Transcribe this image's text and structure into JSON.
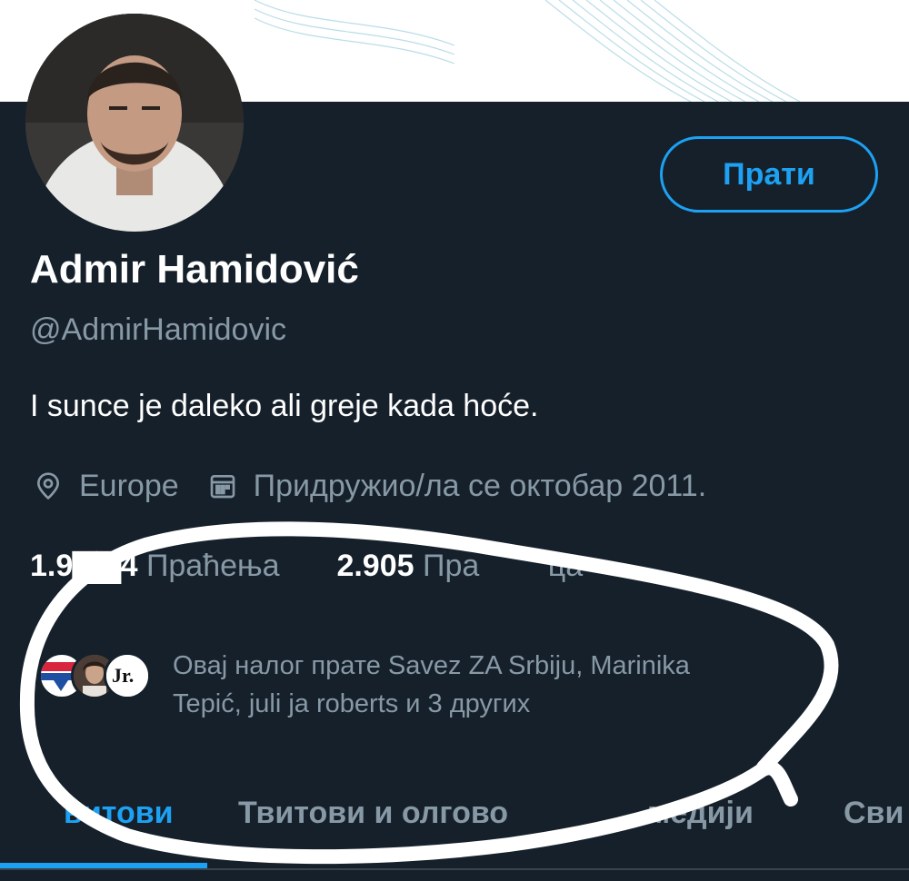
{
  "profile": {
    "display_name": "Admir Hamidović",
    "handle": "@AdmirHamidovic",
    "bio": "I sunce je daleko ali greje kada hoće.",
    "follow_button_label": "Прати",
    "location": "Europe",
    "joined": "Придружио/ла се октобар 2011.",
    "location_icon": "location-pin-icon",
    "joined_icon": "calendar-icon"
  },
  "stats": {
    "following_count": "1.9",
    "following_count_end": "4",
    "following_label": "Праћења",
    "followers_count": "2.905",
    "followers_label_visible": "Пра",
    "followers_label_end": "ца"
  },
  "followed_by": {
    "text_line1": "Овај налог прате Savez ZA Srbiju, Marinika",
    "text_line2": "Tepić, juli ja roberts и 3 других",
    "avatar_icons": [
      "savez-za-srbiju-logo-icon",
      "person-avatar-icon",
      "jr-logo-icon"
    ]
  },
  "tabs": [
    {
      "label": "витови"
    },
    {
      "label": "Твитови и олгово"
    },
    {
      "label": "медији"
    },
    {
      "label": "Сви"
    }
  ],
  "colors": {
    "background": "#15202b",
    "accent": "#1da1f2",
    "secondary_text": "#8899a6",
    "scribble": "#ffffff"
  }
}
